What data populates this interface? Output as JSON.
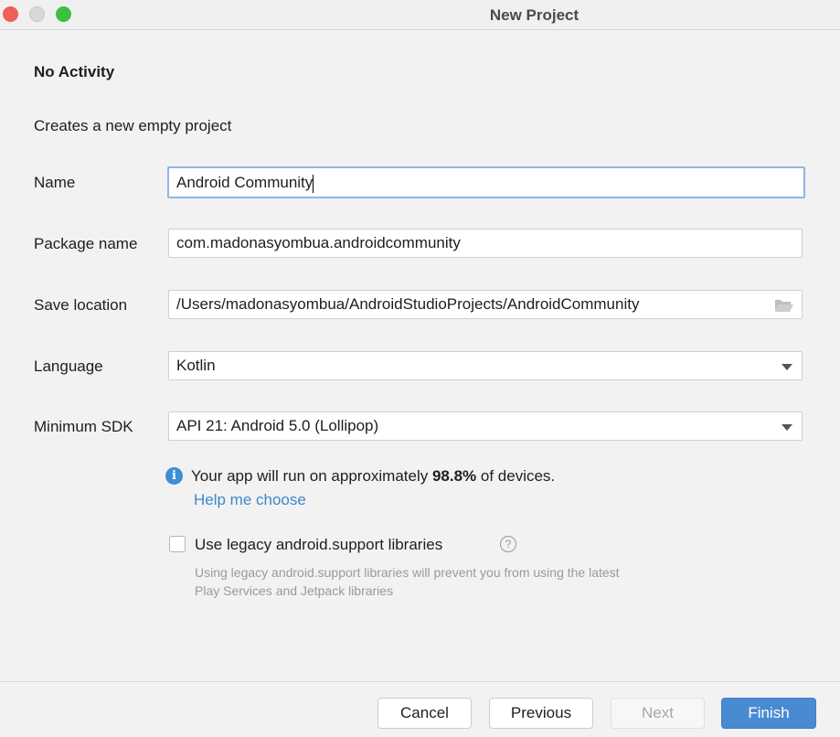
{
  "window": {
    "title": "New Project",
    "controls": {
      "close_color": "#ee5f57",
      "minimize_color": "#d8d8d8",
      "zoom_color": "#3dbf40"
    }
  },
  "page": {
    "heading": "No Activity",
    "description": "Creates a new empty project"
  },
  "form": {
    "name": {
      "label": "Name",
      "value": "Android Community"
    },
    "package": {
      "label": "Package name",
      "value": "com.madonasyombua.androidcommunity"
    },
    "save_location": {
      "label": "Save location",
      "value": "/Users/madonasyombua/AndroidStudioProjects/AndroidCommunity",
      "icon": "folder-icon"
    },
    "language": {
      "label": "Language",
      "value": "Kotlin"
    },
    "min_sdk": {
      "label": "Minimum SDK",
      "value": "API 21: Android 5.0 (Lollipop)"
    }
  },
  "info": {
    "icon": "info-icon",
    "text_before": "Your app will run on approximately ",
    "percent": "98.8%",
    "text_after": " of devices.",
    "help_link": "Help me choose"
  },
  "legacy": {
    "label": "Use legacy android.support libraries",
    "checked": false,
    "help_icon": "?",
    "hint": "Using legacy android.support libraries will prevent you from using the latest Play Services and Jetpack libraries"
  },
  "buttons": {
    "cancel": "Cancel",
    "previous": "Previous",
    "next": "Next",
    "finish": "Finish"
  }
}
